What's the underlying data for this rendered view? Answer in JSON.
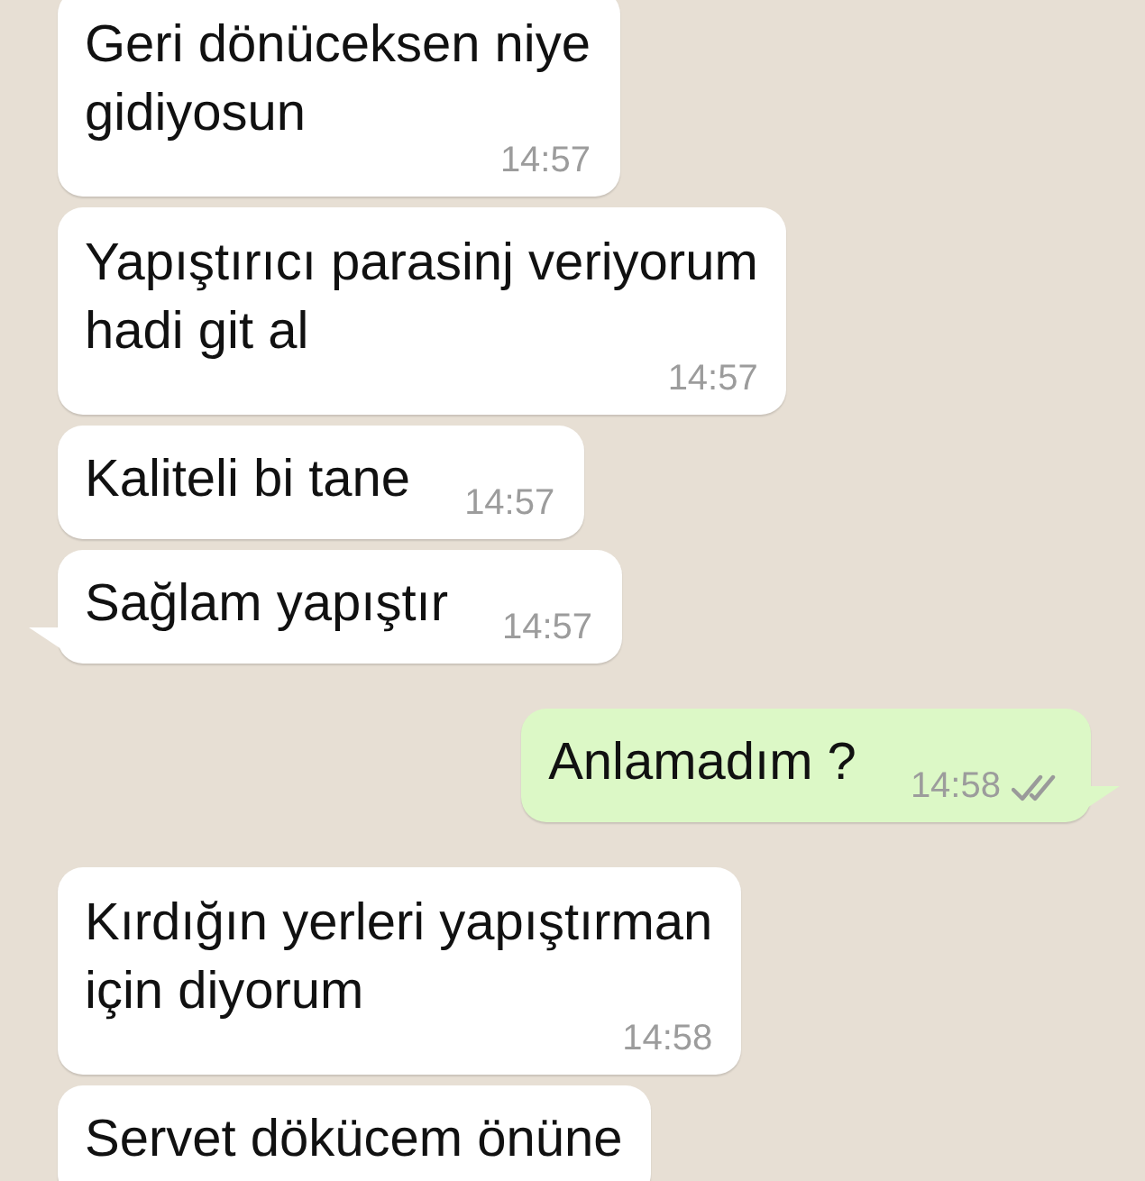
{
  "messages": [
    {
      "kind": "in",
      "text": "Geri dönüceksen niye\ngidiyosun",
      "time": "14:57",
      "tail": false
    },
    {
      "kind": "in",
      "text": "Yapıştırıcı parasinj veriyorum\nhadi git al",
      "time": "14:57",
      "tail": false
    },
    {
      "kind": "in",
      "text": "Kaliteli bi tane",
      "time": "14:57",
      "tail": false
    },
    {
      "kind": "in",
      "text": "Sağlam yapıştır",
      "time": "14:57",
      "tail": true
    },
    {
      "kind": "out",
      "text": "Anlamadım ?",
      "time": "14:58",
      "tail": true,
      "read": false
    },
    {
      "kind": "in",
      "text": "Kırdığın yerleri yapıştırman\niçin diyorum",
      "time": "14:58",
      "tail": false
    },
    {
      "kind": "in",
      "text": "Servet dökücem önüne",
      "tail": false
    }
  ]
}
